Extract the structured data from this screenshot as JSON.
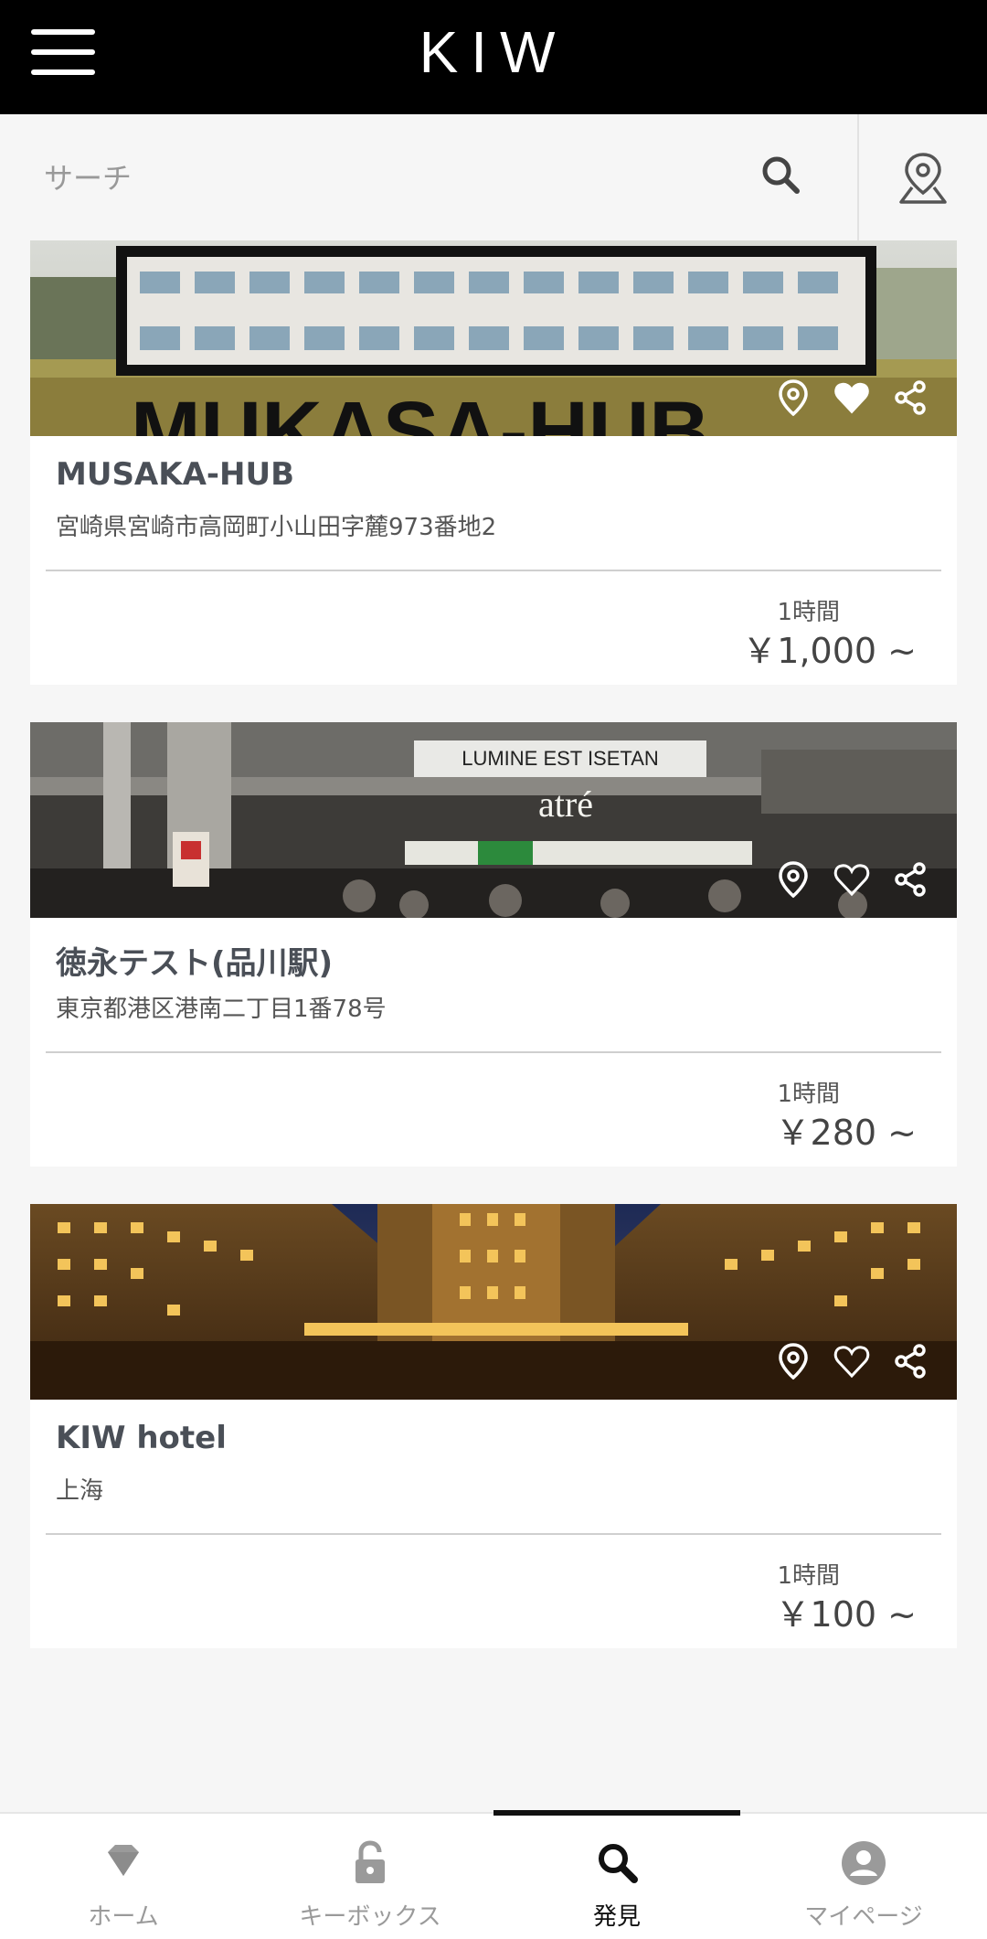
{
  "header": {
    "logo": "KIW",
    "menu_icon": "hamburger-menu-icon"
  },
  "search": {
    "placeholder": "サーチ",
    "search_icon": "search-icon",
    "map_icon": "map-pin-icon"
  },
  "listings": [
    {
      "name": "MUSAKA-HUB",
      "address": "宮崎県宮崎市高岡町小山田字麓973番地2",
      "unit": "1時間",
      "price": "￥1,000 ~",
      "image_text": "MUKASA-HUB",
      "favorited": true
    },
    {
      "name": "徳永テスト(品川駅)",
      "address": "東京都港区港南二丁目1番78号",
      "unit": "1時間",
      "price": "￥280 ~",
      "image_text": "atré",
      "image_sign": "LUMINE EST ISETAN",
      "favorited": false
    },
    {
      "name": "KIW hotel",
      "address": "上海",
      "unit": "1時間",
      "price": "￥100 ~",
      "favorited": false
    }
  ],
  "bottom_nav": {
    "items": [
      {
        "label": "ホーム",
        "icon": "diamond-icon",
        "active": false
      },
      {
        "label": "キーボックス",
        "icon": "lock-icon",
        "active": false
      },
      {
        "label": "発見",
        "icon": "search-icon",
        "active": true
      },
      {
        "label": "マイページ",
        "icon": "user-icon",
        "active": false
      }
    ]
  },
  "colors": {
    "header_bg": "#000000",
    "page_bg": "#f6f6f6",
    "active_nav": "#111111",
    "inactive_nav": "#9a9a9a"
  }
}
